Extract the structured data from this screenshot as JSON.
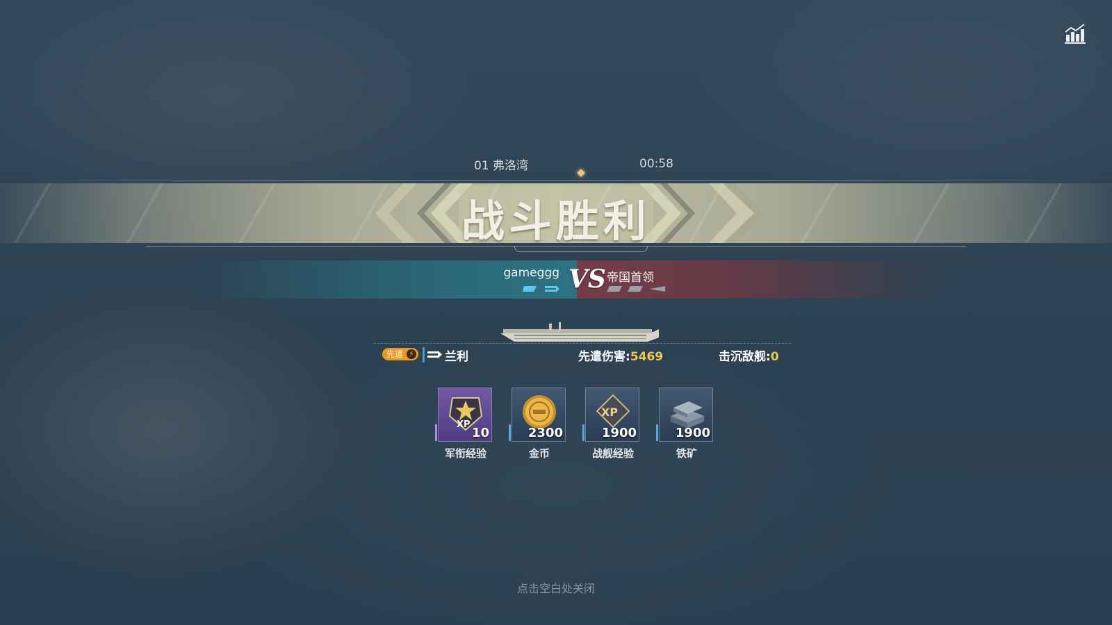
{
  "header": {
    "stats_icon": "stats-chart-icon"
  },
  "battle": {
    "map": "01 弗洛湾",
    "time": "00:58",
    "result": "战斗胜利"
  },
  "matchup": {
    "player": "gameggg",
    "vs": "VS",
    "enemy": "帝国首领",
    "team_color": "#2d7a88",
    "enemy_color": "#7a3a44"
  },
  "ship": {
    "badge": "先遣",
    "name": "兰利",
    "damage_label": "先遣伤害:",
    "damage_value": "5469",
    "sink_label": "击沉敌舰:",
    "sink_value": "0",
    "highlight_color": "#f0c850"
  },
  "rewards": [
    {
      "label": "军衔经验",
      "qty": "10",
      "icon": "rank-xp-icon"
    },
    {
      "label": "金币",
      "qty": "2300",
      "icon": "gold-coin-icon"
    },
    {
      "label": "战舰经验",
      "qty": "1900",
      "icon": "ship-xp-icon"
    },
    {
      "label": "铁矿",
      "qty": "1900",
      "icon": "iron-ore-icon"
    }
  ],
  "footer": {
    "close_hint": "点击空白处关闭"
  }
}
